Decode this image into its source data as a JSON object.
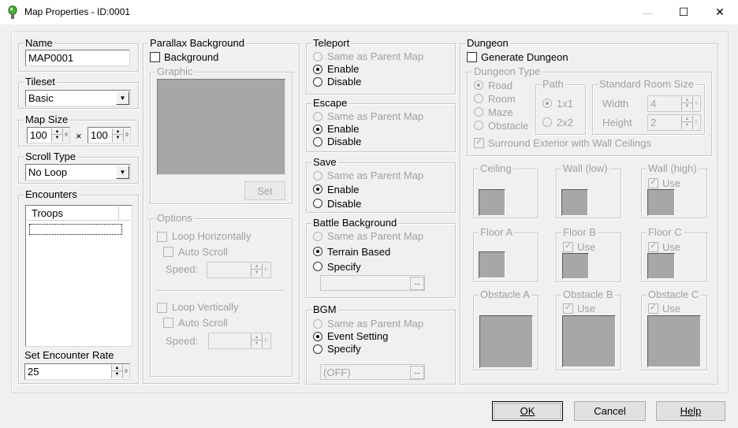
{
  "window": {
    "title": "Map Properties - ID:0001",
    "minimize": "—",
    "maximize": "☐",
    "close": "✕"
  },
  "name": {
    "label": "Name",
    "value": "MAP0001"
  },
  "tileset": {
    "label": "Tileset",
    "value": "Basic"
  },
  "map_size": {
    "label": "Map Size",
    "width": "100",
    "height": "100",
    "times": "×"
  },
  "scroll_type": {
    "label": "Scroll Type",
    "value": "No Loop"
  },
  "encounters": {
    "label": "Encounters",
    "column": "Troops",
    "rate_label": "Set Encounter Rate",
    "rate_value": "25"
  },
  "parallax": {
    "label": "Parallax Background",
    "background_checkbox": "Background",
    "graphic_label": "Graphic",
    "set_button": "Set",
    "options_label": "Options",
    "loop_h": "Loop Horizontally",
    "auto_scroll": "Auto Scroll",
    "speed": "Speed:",
    "loop_v": "Loop Vertically"
  },
  "teleport": {
    "label": "Teleport",
    "opt1": "Same as Parent Map",
    "opt2": "Enable",
    "opt3": "Disable"
  },
  "escape": {
    "label": "Escape",
    "opt1": "Same as Parent Map",
    "opt2": "Enable",
    "opt3": "Disable"
  },
  "save": {
    "label": "Save",
    "opt1": "Same as Parent Map",
    "opt2": "Enable",
    "opt3": "Disable"
  },
  "battle_bg": {
    "label": "Battle Background",
    "opt1": "Same as Parent Map",
    "opt2": "Terrain Based",
    "opt3": "Specify",
    "browse": "..."
  },
  "bgm": {
    "label": "BGM",
    "opt1": "Same as Parent Map",
    "opt2": "Event Setting",
    "opt3": "Specify",
    "value": "(OFF)",
    "browse": "..."
  },
  "dungeon": {
    "label": "Dungeon",
    "generate": "Generate Dungeon",
    "type_label": "Dungeon Type",
    "types": [
      "Road",
      "Room",
      "Maze",
      "Obstacle"
    ],
    "path_label": "Path",
    "path_opts": [
      "1x1",
      "2x2"
    ],
    "room_label": "Standard Room Size",
    "width_label": "Width",
    "width_value": "4",
    "height_label": "Height",
    "height_value": "2",
    "surround": "Surround Exterior with Wall Ceilings",
    "ceiling": "Ceiling",
    "wall_low": "Wall (low)",
    "wall_high": "Wall (high)",
    "floor_a": "Floor A",
    "floor_b": "Floor B",
    "floor_c": "Floor C",
    "obstacle_a": "Obstacle A",
    "obstacle_b": "Obstacle B",
    "obstacle_c": "Obstacle C",
    "use": "Use"
  },
  "buttons": {
    "ok": "OK",
    "cancel": "Cancel",
    "help": "Help"
  }
}
